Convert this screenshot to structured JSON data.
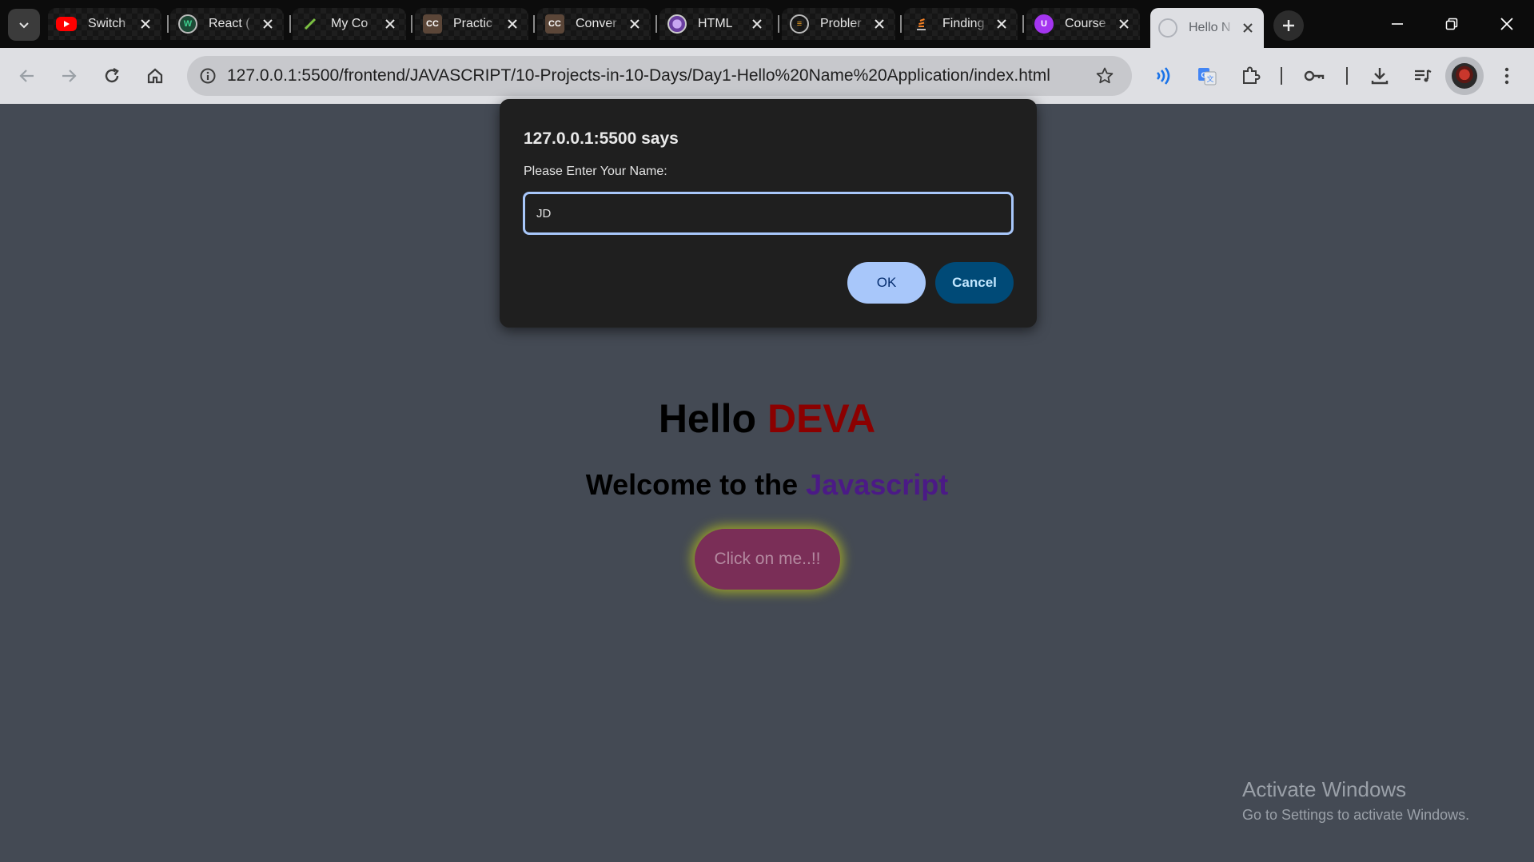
{
  "tabs": [
    {
      "title": "Switch",
      "icon": "youtube-icon"
    },
    {
      "title": "React (",
      "icon": "wappalyzer-icon"
    },
    {
      "title": "My Co",
      "icon": "leaf-icon"
    },
    {
      "title": "Practic",
      "icon": "codechef-icon"
    },
    {
      "title": "Conver",
      "icon": "codechef-icon"
    },
    {
      "title": "HTML",
      "icon": "avatar-icon"
    },
    {
      "title": "Probler",
      "icon": "codeforces-icon"
    },
    {
      "title": "Finding",
      "icon": "stack-overflow-icon"
    },
    {
      "title": "Course",
      "icon": "udemy-icon"
    },
    {
      "title": "Hello N",
      "icon": "globe-icon",
      "active": true
    }
  ],
  "toolbar": {
    "url": "127.0.0.1:5500/frontend/JAVASCRIPT/10-Projects-in-10-Days/Day1-Hello%20Name%20Application/index.html"
  },
  "page": {
    "hello_prefix": "Hello",
    "hello_name": "DEVA",
    "welcome_prefix": "Welcome to the",
    "welcome_js": "Javascript",
    "button_label": "Click on me..!!"
  },
  "dialog": {
    "title": "127.0.0.1:5500 says",
    "message": "Please Enter Your Name:",
    "input_value": "JD",
    "ok_label": "OK",
    "cancel_label": "Cancel"
  },
  "watermark": {
    "line1": "Activate Windows",
    "line2": "Go to Settings to activate Windows."
  },
  "colors": {
    "page_bg": "#444a54",
    "name_color": "#8b0000",
    "js_color": "#4b1a86",
    "button_bg": "#7a2e57",
    "button_glow": "#b4be1e",
    "dialog_bg": "#1f1f1f",
    "ok_bg": "#a8c7fa",
    "cancel_bg": "#004a77"
  }
}
